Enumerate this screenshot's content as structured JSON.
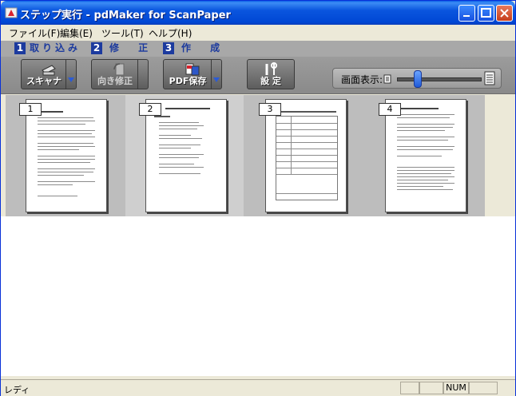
{
  "window": {
    "title": "ステップ実行 - pdMaker for ScanPaper"
  },
  "menu": [
    "ファイル(F)",
    "編集(E)",
    "ツール(T)",
    "ヘルプ(H)"
  ],
  "steps": [
    {
      "num": "1",
      "label": "取り込み"
    },
    {
      "num": "2",
      "label": "修 正"
    },
    {
      "num": "3",
      "label": "作 成"
    }
  ],
  "toolbar": {
    "scan_label": "スキャナ",
    "fix_label": "向き修正",
    "pdf_label": "PDF保存",
    "settings_label": "設 定"
  },
  "zoom": {
    "label": "画面表示:"
  },
  "pages": [
    "1",
    "2",
    "3",
    "4"
  ],
  "status": {
    "text": "レディ",
    "num": "NUM"
  }
}
